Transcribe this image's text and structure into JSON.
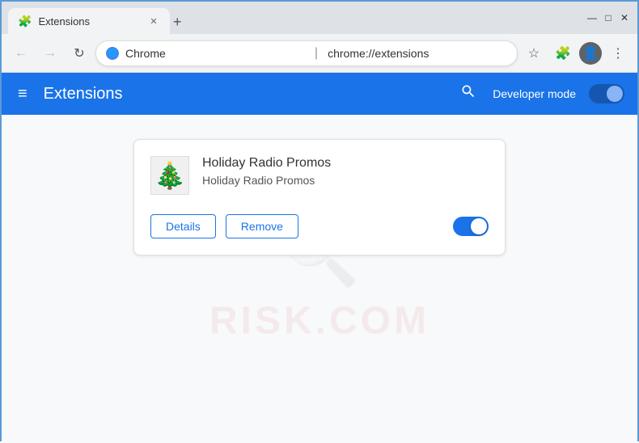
{
  "browser": {
    "tab": {
      "title": "Extensions",
      "favicon": "🧩"
    },
    "new_tab_label": "+",
    "window_controls": {
      "minimize": "—",
      "maximize": "□",
      "close": "✕"
    },
    "nav": {
      "back": "←",
      "forward": "→",
      "refresh": "↻"
    },
    "address": {
      "site_name": "Chrome",
      "url": "chrome://extensions",
      "separator": "|"
    },
    "toolbar": {
      "star": "☆",
      "extension": "🧩",
      "account": "👤",
      "menu": "⋮"
    }
  },
  "extensions_page": {
    "header": {
      "menu_icon": "≡",
      "title": "Extensions",
      "search_icon": "🔍",
      "developer_mode_label": "Developer mode"
    },
    "extension_card": {
      "name": "Holiday Radio Promos",
      "description": "Holiday Radio Promos",
      "logo_emoji": "🎄",
      "details_button": "Details",
      "remove_button": "Remove",
      "toggle_enabled": true
    }
  },
  "watermark": {
    "text": "RISK.COM"
  }
}
